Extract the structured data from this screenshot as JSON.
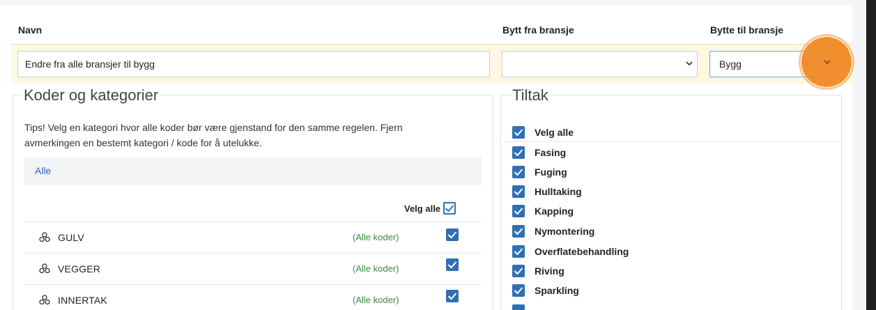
{
  "header": {
    "navn_label": "Navn",
    "bytt_fra_label": "Bytt fra bransje",
    "bytte_til_label": "Bytte til bransje"
  },
  "form": {
    "name_value": "Endre fra alle bransjer til bygg",
    "from_value": "",
    "to_value": "Bygg"
  },
  "koder": {
    "legend": "Koder og kategorier",
    "tips": "Tips! Velg en kategori hvor alle koder bør være gjenstand for den samme regelen. Fjern avmerkingen en bestemt kategori / kode for å utelukke.",
    "tab": "Alle",
    "select_all_label": "Velg alle",
    "rows": [
      {
        "name": "GULV",
        "tag": "(Alle koder)"
      },
      {
        "name": "VEGGER",
        "tag": "(Alle koder)"
      },
      {
        "name": "INNERTAK",
        "tag": "(Alle koder)"
      }
    ]
  },
  "tiltak": {
    "legend": "Tiltak",
    "items": [
      "Velg alle",
      "Fasing",
      "Fuging",
      "Hulltaking",
      "Kapping",
      "Nymontering",
      "Overflatebehandling",
      "Riving",
      "Sparkling"
    ]
  },
  "colors": {
    "accent": "#2f6fb5",
    "highlight_row": "#fdf8e2",
    "cursor_marker": "#f0841e",
    "tag_green": "#3a8a3a"
  }
}
